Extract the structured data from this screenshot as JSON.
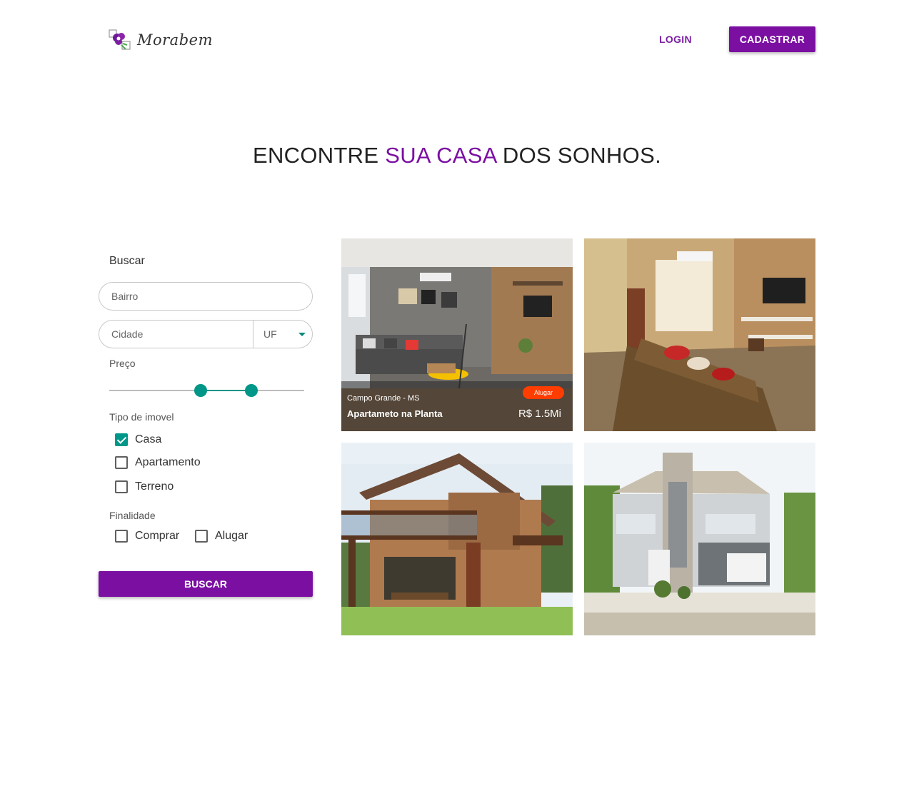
{
  "header": {
    "logo_text": "Morabem",
    "login_label": "LOGIN",
    "signup_label": "CADASTRAR"
  },
  "hero": {
    "part1": "ENCONTRE ",
    "accent": "SUA CASA",
    "part2": " DOS SONHOS."
  },
  "search": {
    "title": "Buscar",
    "bairro_placeholder": "Bairro",
    "cidade_placeholder": "Cidade",
    "uf_label": "UF",
    "price_label": "Preço",
    "price_range": {
      "low": 0.47,
      "high": 0.73
    },
    "type_label": "Tipo de imovel",
    "types": [
      {
        "label": "Casa",
        "checked": true
      },
      {
        "label": "Apartamento",
        "checked": false
      },
      {
        "label": "Terreno",
        "checked": false
      }
    ],
    "purpose_label": "Finalidade",
    "purposes": [
      {
        "label": "Comprar",
        "checked": false
      },
      {
        "label": "Alugar",
        "checked": false
      }
    ],
    "submit_label": "BUSCAR"
  },
  "listings": [
    {
      "city": "Campo Grande - MS",
      "title": "Apartameto na Planta",
      "badge": "Alugar",
      "price": "R$ 1.5Mi"
    }
  ],
  "colors": {
    "primary": "#7b0fa2",
    "accent": "#009688",
    "badge": "#ff3d00"
  }
}
